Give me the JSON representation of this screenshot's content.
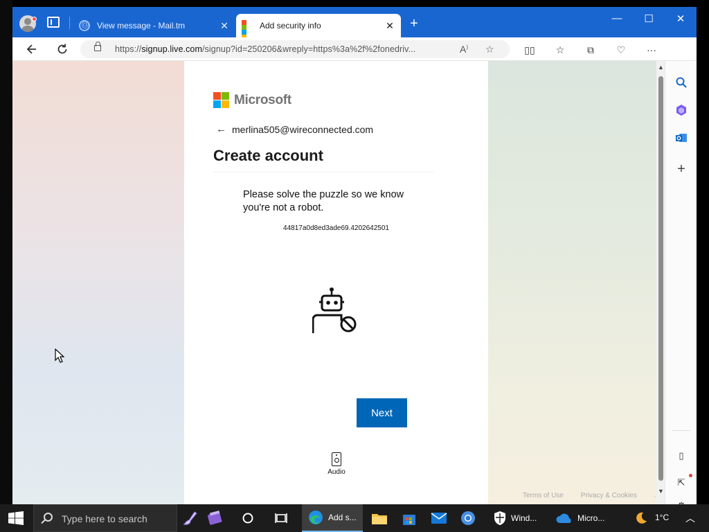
{
  "browser": {
    "tabs": [
      {
        "title": "View message - Mail.tm",
        "close": "✕"
      },
      {
        "title": "Add security info",
        "close": "✕"
      }
    ],
    "new_tab": "+",
    "window_controls": {
      "minimize": "—",
      "maximize": "☐",
      "close": "✕"
    },
    "url_prefix": "https://",
    "url_host": "signup.live.com",
    "url_rest": "/signup?id=250206&wreply=https%3a%2f%2fonedriv..."
  },
  "page": {
    "brand": "Microsoft",
    "identity": "merlina505@wireconnected.com",
    "back_arrow": "←",
    "heading": "Create account",
    "puzzle_text": "Please solve the puzzle so we know you're not a robot.",
    "puzzle_id": "44817a0d8ed3ade69.4202642501",
    "next_label": "Next",
    "audio_label": "Audio",
    "footer_links": [
      "Terms of Use",
      "Privacy & Cookies",
      "..."
    ]
  },
  "taskbar": {
    "search_placeholder": "Type here to search",
    "apps": [
      {
        "name": "edge",
        "label": "Add s..."
      },
      {
        "name": "defender",
        "label": "Wind..."
      },
      {
        "name": "onedrive",
        "label": "Micro..."
      }
    ],
    "weather": "1°C"
  },
  "colors": {
    "tabbar": "#1a66d1",
    "primary_button": "#0067b8",
    "ms_red": "#f25022",
    "ms_green": "#7fba00",
    "ms_blue": "#00a4ef",
    "ms_yellow": "#ffb900"
  }
}
